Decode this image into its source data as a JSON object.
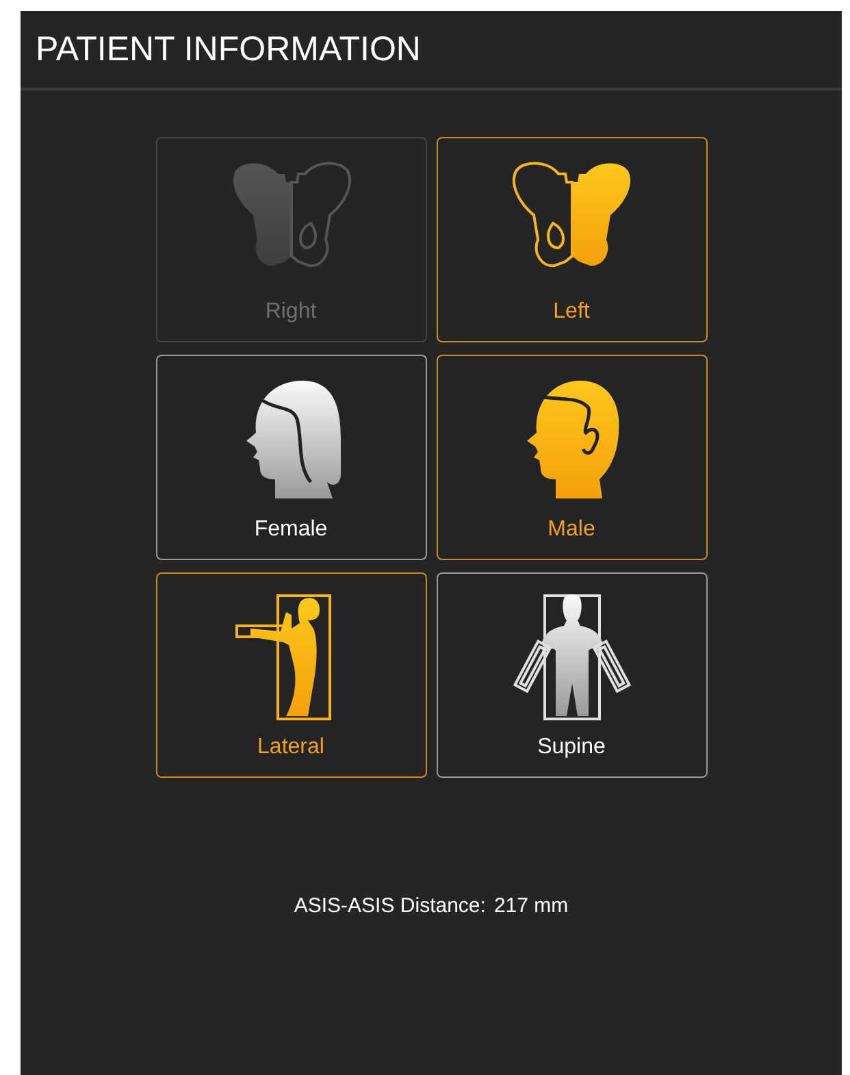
{
  "window": {
    "title": "PATIENT INFORMATION"
  },
  "tiles": [
    {
      "kind": "pelvis_right",
      "label": "Right",
      "selected": false,
      "disabled": true
    },
    {
      "kind": "pelvis_left",
      "label": "Left",
      "selected": true,
      "disabled": false
    },
    {
      "kind": "female",
      "label": "Female",
      "selected": false,
      "disabled": false
    },
    {
      "kind": "male",
      "label": "Male",
      "selected": true,
      "disabled": false
    },
    {
      "kind": "lateral",
      "label": "Lateral",
      "selected": true,
      "disabled": false
    },
    {
      "kind": "supine",
      "label": "Supine",
      "selected": false,
      "disabled": false
    }
  ],
  "distance": {
    "label": "ASIS-ASIS Distance:",
    "value": "217 mm"
  }
}
